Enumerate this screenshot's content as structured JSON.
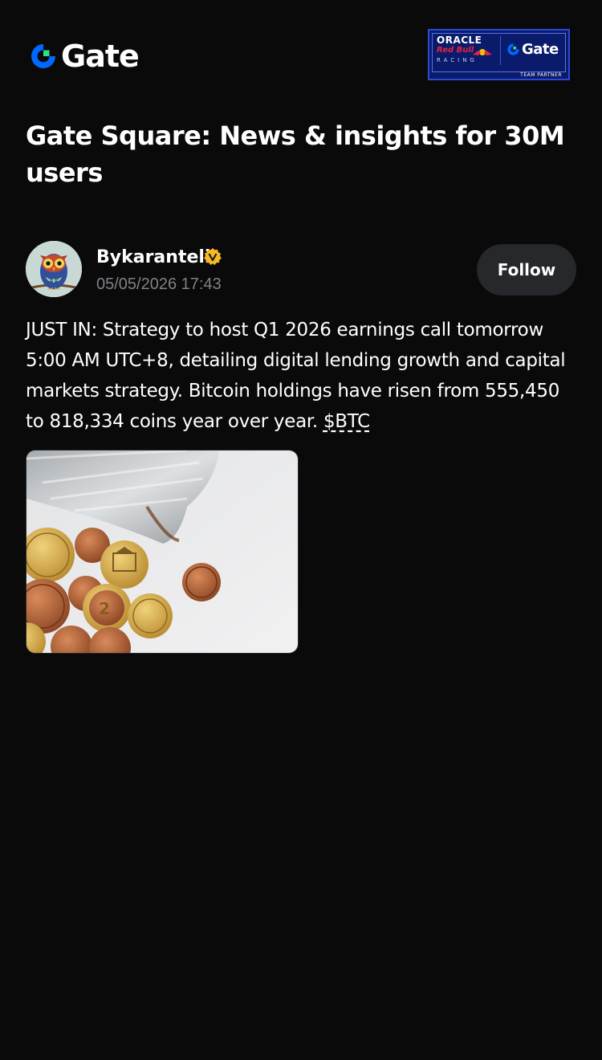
{
  "header": {
    "logo_text": "Gate",
    "logo_icon": "gate-logo-icon",
    "partner_badge": {
      "oracle": "ORACLE",
      "redbull": "Red Bull",
      "racing": "RACING",
      "gate": "Gate",
      "partner": "TEAM PARTNER"
    }
  },
  "page": {
    "title": "Gate Square: News & insights for 30M users"
  },
  "post": {
    "author": "Bykaranteli",
    "verified_icon": "verified-badge-icon",
    "timestamp": "05/05/2026 17:43",
    "follow_label": "Follow",
    "body_text": "JUST IN: Strategy to host Q1 2026 earnings call tomorrow 5:00 AM UTC+8, detailing digital lending growth and capital markets strategy. Bitcoin holdings have risen from 555,450 to 818,334 coins year over year. ",
    "ticker": "$BTC",
    "image_alt": "coins-spilling-from-jar-photo"
  },
  "colors": {
    "background": "#0a0a0b",
    "follow_button_bg": "#26282c",
    "muted_text": "#808186",
    "brand_blue": "#0068ff",
    "brand_green": "#2de08a",
    "verified_gold": "#f7b924"
  }
}
